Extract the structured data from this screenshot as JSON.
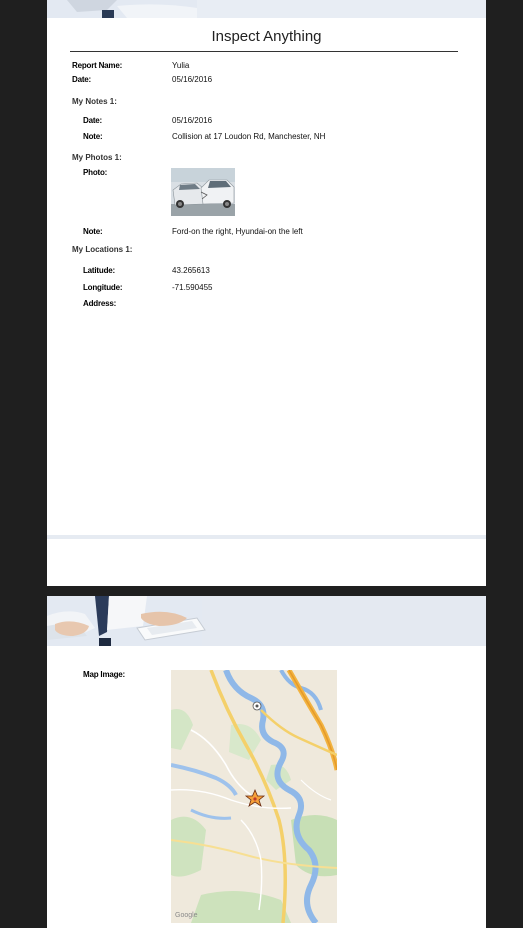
{
  "report": {
    "title": "Inspect Anything",
    "report_name_label": "Report Name:",
    "report_name_value": "Yulia",
    "date_label": "Date:",
    "date_value": "05/16/2016"
  },
  "notes": {
    "section_label": "My Notes 1:",
    "date_label": "Date:",
    "date_value": "05/16/2016",
    "note_label": "Note:",
    "note_value": "Collision at 17 Loudon Rd, Manchester, NH"
  },
  "photos": {
    "section_label": "My Photos 1:",
    "photo_label": "Photo:",
    "note_label": "Note:",
    "note_value": "Ford-on the right, Hyundai-on the left"
  },
  "locations": {
    "section_label": "My Locations 1:",
    "latitude_label": "Latitude:",
    "latitude_value": "43.265613",
    "longitude_label": "Longitude:",
    "longitude_value": "-71.590455",
    "address_label": "Address:",
    "address_value": ""
  },
  "map": {
    "label": "Map Image:",
    "attribution": "Google"
  },
  "colors": {
    "background": "#1f1f1f",
    "page": "#ffffff",
    "header_band": "#e3e9f2"
  }
}
